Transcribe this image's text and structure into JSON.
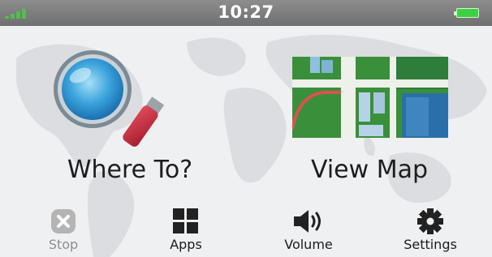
{
  "status": {
    "time": "10:27",
    "signal_icon": "signal-bars-icon",
    "battery_icon": "battery-full-icon",
    "signal_color": "#4fc04a",
    "battery_color": "#3ed044"
  },
  "main": {
    "tiles": [
      {
        "label": "Where To?",
        "icon": "magnifying-glass-icon"
      },
      {
        "label": "View Map",
        "icon": "map-icon"
      }
    ]
  },
  "bottom": {
    "buttons": [
      {
        "label": "Stop",
        "icon": "stop-x-icon",
        "enabled": false
      },
      {
        "label": "Apps",
        "icon": "apps-grid-icon",
        "enabled": true
      },
      {
        "label": "Volume",
        "icon": "speaker-icon",
        "enabled": true
      },
      {
        "label": "Settings",
        "icon": "gear-icon",
        "enabled": true
      }
    ]
  }
}
